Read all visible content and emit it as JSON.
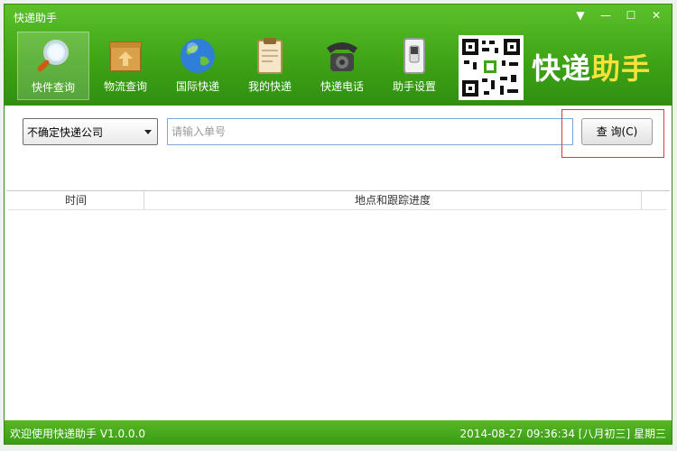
{
  "window": {
    "title": "快递助手",
    "controls": {
      "menu": "▼",
      "minimize": "—",
      "maximize": "☐",
      "close": "✕"
    }
  },
  "toolbar": {
    "items": [
      {
        "label": "快件查询",
        "icon": "magnifier-icon",
        "active": true
      },
      {
        "label": "物流查询",
        "icon": "package-box-icon",
        "active": false
      },
      {
        "label": "国际快递",
        "icon": "globe-icon",
        "active": false
      },
      {
        "label": "我的快递",
        "icon": "clipboard-icon",
        "active": false
      },
      {
        "label": "快递电话",
        "icon": "telephone-icon",
        "active": false
      },
      {
        "label": "助手设置",
        "icon": "switch-icon",
        "active": false
      }
    ]
  },
  "brand": {
    "part1": "快递",
    "part2": "助手"
  },
  "query": {
    "company_select": "不确定快递公司",
    "tracking_placeholder": "请输入单号",
    "search_button": "查 询(C)"
  },
  "table": {
    "columns": [
      "时间",
      "地点和跟踪进度"
    ],
    "rows": []
  },
  "status": {
    "welcome": "欢迎使用快递助手 V1.0.0.0",
    "datetime": "2014-08-27 09:36:34 [八月初三]  星期三"
  },
  "colors": {
    "brand_green": "#3fa417",
    "accent_yellow": "#f6e23a",
    "highlight_red": "#d93a3a"
  }
}
